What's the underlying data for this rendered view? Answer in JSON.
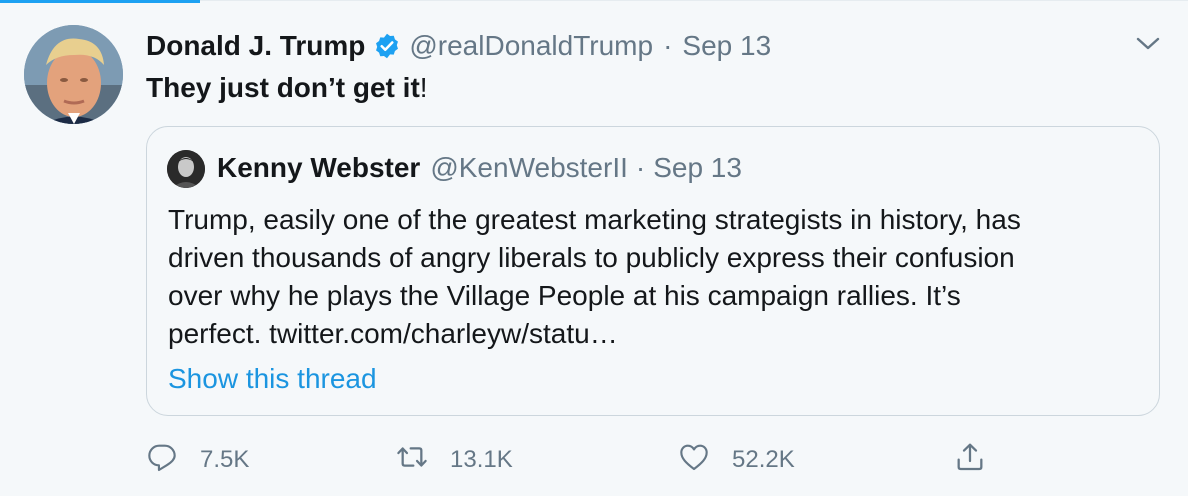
{
  "tweet": {
    "author": {
      "display_name": "Donald J. Trump",
      "handle": "@realDonaldTrump",
      "verified": true
    },
    "separator": "·",
    "timestamp": "Sep 13",
    "text_main": "They just don’t get it",
    "text_punct": "!",
    "quoted_tweet": {
      "author": {
        "display_name": "Kenny Webster",
        "handle": "@KenWebsterII"
      },
      "separator": "·",
      "timestamp": "Sep 13",
      "body_lines": [
        "Trump, easily one of the greatest marketing strategists in history, has",
        "driven thousands of angry liberals to publicly express their confusion",
        "over why he plays the Village People at his campaign rallies. It’s",
        "perfect. twitter.com/charleyw/statu…"
      ],
      "show_thread_label": "Show this thread"
    },
    "actions": {
      "reply_count": "7.5K",
      "retweet_count": "13.1K",
      "like_count": "52.2K"
    }
  },
  "icons": {
    "verified": "verified-badge-icon",
    "caret": "chevron-down-icon",
    "reply": "reply-icon",
    "retweet": "retweet-icon",
    "like": "heart-icon",
    "share": "share-icon"
  },
  "colors": {
    "background": "#f5f8fa",
    "accent": "#1da1f2",
    "link": "#1b95e0",
    "text_primary": "#14171a",
    "text_secondary": "#657786",
    "border": "#ccd6dd"
  }
}
